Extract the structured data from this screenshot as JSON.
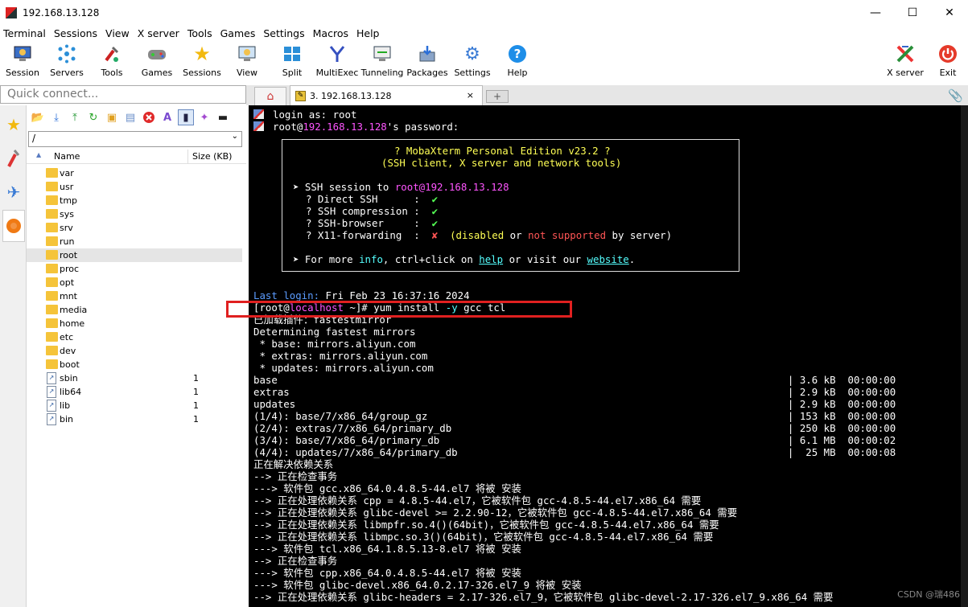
{
  "window": {
    "title": "192.168.13.128",
    "minimize": "—",
    "maximize": "☐",
    "close": "✕"
  },
  "menu": [
    "Terminal",
    "Sessions",
    "View",
    "X server",
    "Tools",
    "Games",
    "Settings",
    "Macros",
    "Help"
  ],
  "toolbar": {
    "items": [
      {
        "label": "Session",
        "icon": "session-icon"
      },
      {
        "label": "Servers",
        "icon": "servers-icon"
      },
      {
        "label": "Tools",
        "icon": "tools-icon"
      },
      {
        "label": "Games",
        "icon": "games-icon"
      },
      {
        "label": "Sessions",
        "icon": "star-icon"
      },
      {
        "label": "View",
        "icon": "view-icon"
      },
      {
        "label": "Split",
        "icon": "split-icon"
      },
      {
        "label": "MultiExec",
        "icon": "multiexec-icon"
      },
      {
        "label": "Tunneling",
        "icon": "tunneling-icon"
      },
      {
        "label": "Packages",
        "icon": "packages-icon"
      },
      {
        "label": "Settings",
        "icon": "gear-icon"
      },
      {
        "label": "Help",
        "icon": "help-icon"
      }
    ],
    "xserver_label": "X server",
    "exit_label": "Exit"
  },
  "quick_connect": {
    "placeholder": "Quick connect..."
  },
  "tabs": {
    "active_label": "3. 192.168.13.128",
    "close": "×",
    "new": "+"
  },
  "sftp": {
    "path": "/",
    "columns": {
      "name": "Name",
      "size": "Size (KB)"
    },
    "files": [
      {
        "name": "var",
        "size": "",
        "type": "folder"
      },
      {
        "name": "usr",
        "size": "",
        "type": "folder"
      },
      {
        "name": "tmp",
        "size": "",
        "type": "folder"
      },
      {
        "name": "sys",
        "size": "",
        "type": "folder"
      },
      {
        "name": "srv",
        "size": "",
        "type": "folder"
      },
      {
        "name": "run",
        "size": "",
        "type": "folder"
      },
      {
        "name": "root",
        "size": "",
        "type": "folder",
        "selected": true
      },
      {
        "name": "proc",
        "size": "",
        "type": "folder"
      },
      {
        "name": "opt",
        "size": "",
        "type": "folder"
      },
      {
        "name": "mnt",
        "size": "",
        "type": "folder"
      },
      {
        "name": "media",
        "size": "",
        "type": "folder"
      },
      {
        "name": "home",
        "size": "",
        "type": "folder"
      },
      {
        "name": "etc",
        "size": "",
        "type": "folder"
      },
      {
        "name": "dev",
        "size": "",
        "type": "folder"
      },
      {
        "name": "boot",
        "size": "",
        "type": "folder"
      },
      {
        "name": "sbin",
        "size": "1",
        "type": "link"
      },
      {
        "name": "lib64",
        "size": "1",
        "type": "link"
      },
      {
        "name": "lib",
        "size": "1",
        "type": "link"
      },
      {
        "name": "bin",
        "size": "1",
        "type": "link"
      }
    ]
  },
  "terminal": {
    "login_line": "login as: root",
    "password_user": "root@",
    "password_host": "192.168.13.128",
    "password_suffix": "'s password:",
    "box_title1": "? MobaXterm Personal Edition v23.2 ?",
    "box_title2": "(SSH client, X server and network tools)",
    "ssh_session_prefix": "➤ SSH session to ",
    "ssh_session_target": "root@192.168.13.128",
    "direct_ssh": "? Direct SSH      :",
    "ssh_compression": "? SSH compression :",
    "ssh_browser": "? SSH-browser     :",
    "x11_forwarding": "? X11-forwarding  :",
    "check": "✔",
    "cross": "✘",
    "x11_note_open": "(",
    "x11_disabled": "disabled",
    "x11_or": " or ",
    "x11_not_supported": "not supported",
    "x11_by_server": " by server)",
    "more_prefix": "➤ For more ",
    "more_info": "info",
    "more_mid": ", ctrl+click on ",
    "more_help": "help",
    "more_or": " or visit our ",
    "more_website": "website",
    "more_dot": ".",
    "last_login_label": "Last login:",
    "last_login_value": " Fri Feb 23 16:37:16 2024",
    "prompt_open": "[root@",
    "prompt_host": "localhost",
    "prompt_rest": " ~]# yum install ",
    "prompt_flag": "-y",
    "prompt_args": " gcc tcl",
    "output_lines": [
      "已加载插件：fastestmirror",
      "Determining fastest mirrors",
      " * base: mirrors.aliyun.com",
      " * extras: mirrors.aliyun.com",
      " * updates: mirrors.aliyun.com",
      "base                                                                                     | 3.6 kB  00:00:00",
      "extras                                                                                   | 2.9 kB  00:00:00",
      "updates                                                                                  | 2.9 kB  00:00:00",
      "(1/4): base/7/x86_64/group_gz                                                            | 153 kB  00:00:00",
      "(2/4): extras/7/x86_64/primary_db                                                        | 250 kB  00:00:00",
      "(3/4): base/7/x86_64/primary_db                                                          | 6.1 MB  00:00:02",
      "(4/4): updates/7/x86_64/primary_db                                                       |  25 MB  00:00:08",
      "正在解决依赖关系",
      "--> 正在检查事务",
      "---> 软件包 gcc.x86_64.0.4.8.5-44.el7 将被 安装",
      "--> 正在处理依赖关系 cpp = 4.8.5-44.el7，它被软件包 gcc-4.8.5-44.el7.x86_64 需要",
      "--> 正在处理依赖关系 glibc-devel >= 2.2.90-12，它被软件包 gcc-4.8.5-44.el7.x86_64 需要",
      "--> 正在处理依赖关系 libmpfr.so.4()(64bit)，它被软件包 gcc-4.8.5-44.el7.x86_64 需要",
      "--> 正在处理依赖关系 libmpc.so.3()(64bit)，它被软件包 gcc-4.8.5-44.el7.x86_64 需要",
      "---> 软件包 tcl.x86_64.1.8.5.13-8.el7 将被 安装",
      "--> 正在检查事务",
      "---> 软件包 cpp.x86_64.0.4.8.5-44.el7 将被 安装",
      "---> 软件包 glibc-devel.x86_64.0.2.17-326.el7_9 将被 安装",
      "--> 正在处理依赖关系 glibc-headers = 2.17-326.el7_9，它被软件包 glibc-devel-2.17-326.el7_9.x86_64 需要"
    ]
  },
  "watermark": "CSDN @瑞486"
}
